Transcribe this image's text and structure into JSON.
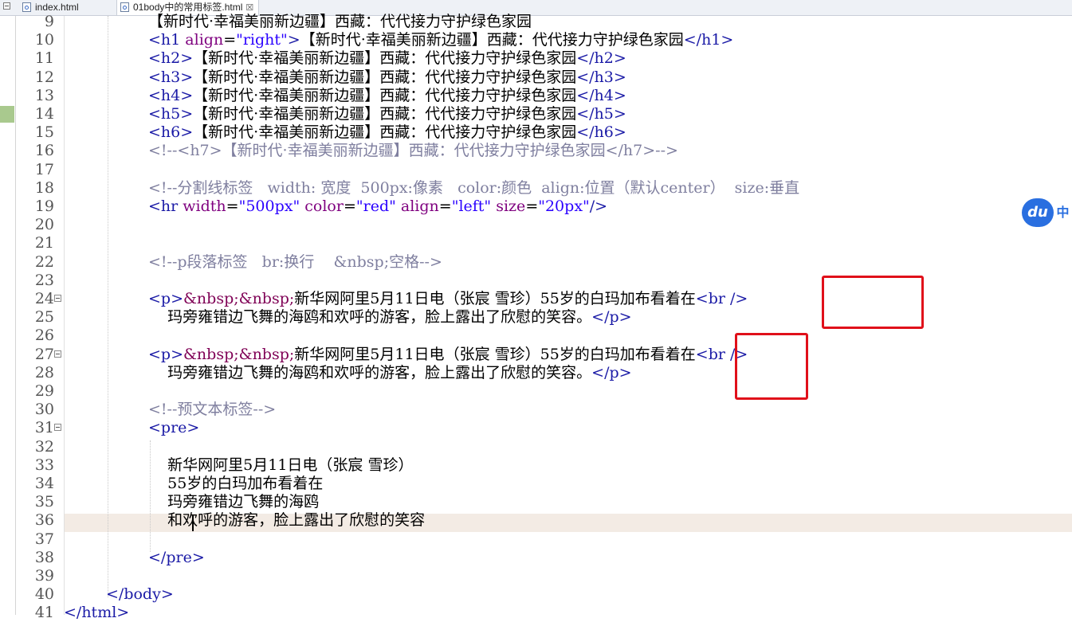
{
  "tabs": [
    {
      "label": "index.html",
      "active": false
    },
    {
      "label": "01body中的常用标签.html",
      "active": true,
      "close": "☒"
    }
  ],
  "badge": {
    "logo": "du",
    "text": "中"
  },
  "colors": {
    "tag": "#1a1aa6",
    "attribute": "#7f007f",
    "value": "#2a00ff",
    "entity": "#7f0055",
    "comment": "#7f7f9f",
    "highlight_box": "#e0101a",
    "current_line": "#f3ebe4",
    "badge": "#2a6fe0"
  },
  "lines": [
    {
      "n": "9",
      "t": "【新时代·幸福美丽新边疆】西藏：代代接力守护绿色家园"
    },
    {
      "n": "10",
      "t": "<h1 align=\"right\">【新时代·幸福美丽新边疆】西藏：代代接力守护绿色家园</h1>"
    },
    {
      "n": "11",
      "t": "<h2>【新时代·幸福美丽新边疆】西藏：代代接力守护绿色家园</h2>"
    },
    {
      "n": "12",
      "t": "<h3>【新时代·幸福美丽新边疆】西藏：代代接力守护绿色家园</h3>"
    },
    {
      "n": "13",
      "t": "<h4>【新时代·幸福美丽新边疆】西藏：代代接力守护绿色家园</h4>"
    },
    {
      "n": "14",
      "t": "<h5>【新时代·幸福美丽新边疆】西藏：代代接力守护绿色家园</h5>"
    },
    {
      "n": "15",
      "t": "<h6>【新时代·幸福美丽新边疆】西藏：代代接力守护绿色家园</h6>"
    },
    {
      "n": "16",
      "t": "<!--<h7>【新时代·幸福美丽新边疆】西藏：代代接力守护绿色家园</h7>-->"
    },
    {
      "n": "17",
      "t": ""
    },
    {
      "n": "18",
      "t": "<!--分割线标签   width: 宽度  500px:像素   color:颜色  align:位置（默认center）  size:垂直"
    },
    {
      "n": "19",
      "t": "<hr width=\"500px\" color=\"red\" align=\"left\" size=\"20px\"/>"
    },
    {
      "n": "20",
      "t": ""
    },
    {
      "n": "21",
      "t": ""
    },
    {
      "n": "22",
      "t": "<!--p段落标签   br:换行    &nbsp;空格-->"
    },
    {
      "n": "23",
      "t": ""
    },
    {
      "n": "24",
      "t": "<p>&nbsp;&nbsp;新华网阿里5月11日电（张宸 雪珍）55岁的白玛加布看着在<br />"
    },
    {
      "n": "25",
      "t": "    玛旁雍错边飞舞的海鸥和欢呼的游客，脸上露出了欣慰的笑容。</p>"
    },
    {
      "n": "26",
      "t": ""
    },
    {
      "n": "27",
      "t": "<p>&nbsp;&nbsp;新华网阿里5月11日电（张宸 雪珍）55岁的白玛加布看着在<br />"
    },
    {
      "n": "28",
      "t": "    玛旁雍错边飞舞的海鸥和欢呼的游客，脸上露出了欣慰的笑容。</p>"
    },
    {
      "n": "29",
      "t": ""
    },
    {
      "n": "30",
      "t": "<!--预文本标签-->"
    },
    {
      "n": "31",
      "t": "<pre>"
    },
    {
      "n": "32",
      "t": ""
    },
    {
      "n": "33",
      "t": "    新华网阿里5月11日电（张宸 雪珍）"
    },
    {
      "n": "34",
      "t": "    55岁的白玛加布看着在"
    },
    {
      "n": "35",
      "t": "    玛旁雍错边飞舞的海鸥"
    },
    {
      "n": "36",
      "t": "    和欢呼的游客，脸上露出了欣慰的笑容"
    },
    {
      "n": "37",
      "t": ""
    },
    {
      "n": "38",
      "t": "</pre>"
    },
    {
      "n": "39",
      "t": ""
    },
    {
      "n": "40",
      "t": "</body>"
    },
    {
      "n": "41",
      "t": "</html>"
    }
  ]
}
